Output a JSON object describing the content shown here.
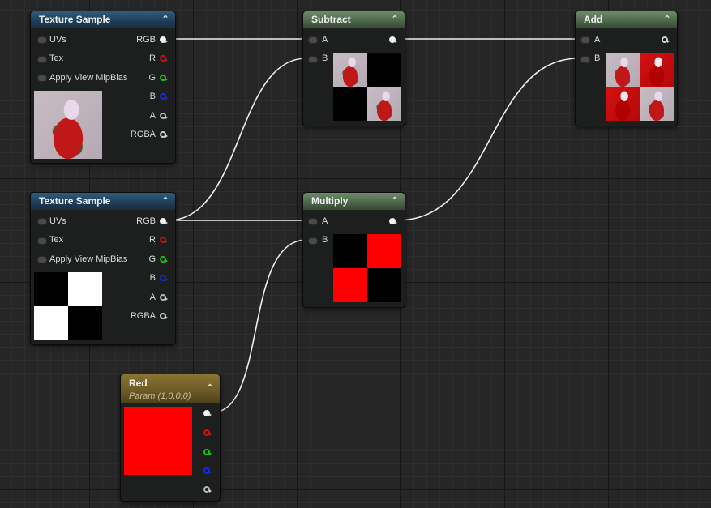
{
  "nodes": {
    "texture1": {
      "title": "Texture Sample",
      "inputs": [
        "UVs",
        "Tex",
        "Apply View MipBias"
      ],
      "outputs": [
        "RGB",
        "R",
        "G",
        "B",
        "A",
        "RGBA"
      ]
    },
    "texture2": {
      "title": "Texture Sample",
      "inputs": [
        "UVs",
        "Tex",
        "Apply View MipBias"
      ],
      "outputs": [
        "RGB",
        "R",
        "G",
        "B",
        "A",
        "RGBA"
      ]
    },
    "subtract": {
      "title": "Subtract",
      "inputs": [
        "A",
        "B"
      ]
    },
    "multiply": {
      "title": "Multiply",
      "inputs": [
        "A",
        "B"
      ]
    },
    "add": {
      "title": "Add",
      "inputs": [
        "A",
        "B"
      ]
    },
    "red": {
      "title": "Red",
      "subtitle": "Param (1,0,0,0)"
    }
  },
  "colors": {
    "background": "#262626",
    "texture_header": "#2f5c7e",
    "math_header": "#6e8a6a",
    "param_header": "#8a7332",
    "wire": "#f0f0f0",
    "red_channel": "#d01010",
    "green_channel": "#13c513",
    "blue_channel": "#1a2ae0",
    "param_color": "#ff0000"
  },
  "icons": [
    "collapse-chevron-icon",
    "input-pin-icon",
    "output-pin-icon"
  ]
}
